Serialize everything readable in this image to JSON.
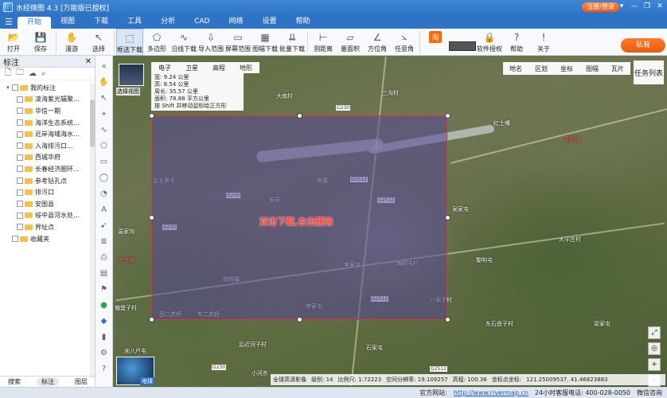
{
  "app": {
    "title": "水经微图 4.3 [万能版已授权]",
    "login_label": "注册/登录",
    "window_controls": [
      "▾",
      "—",
      "❐",
      "✕"
    ]
  },
  "menu": {
    "items": [
      "开始",
      "视图",
      "下载",
      "工具",
      "分析",
      "CAD",
      "网络",
      "设置",
      "帮助"
    ],
    "active_index": 0
  },
  "toolbar": {
    "buttons": [
      {
        "label": "打开",
        "icon": "folder-open-icon"
      },
      {
        "label": "保存",
        "icon": "save-icon"
      },
      {
        "label": "漫游",
        "icon": "hand-icon"
      },
      {
        "label": "选择",
        "icon": "pointer-icon"
      },
      {
        "label": "框选下载",
        "icon": "box-select-icon",
        "selected": true
      },
      {
        "label": "多边形",
        "icon": "polygon-icon"
      },
      {
        "label": "沿线下载",
        "icon": "line-download-icon"
      },
      {
        "label": "导入范围",
        "icon": "import-icon"
      },
      {
        "label": "屏幕范围",
        "icon": "screen-icon"
      },
      {
        "label": "图幅下载",
        "icon": "sheet-icon"
      },
      {
        "label": "批量下载",
        "icon": "batch-icon"
      },
      {
        "label": "测距离",
        "icon": "ruler-icon"
      },
      {
        "label": "量面积",
        "icon": "area-icon"
      },
      {
        "label": "方位角",
        "icon": "azimuth-icon"
      },
      {
        "label": "任意角",
        "icon": "angle-icon"
      },
      {
        "label": "软件授权",
        "icon": "lock-icon"
      },
      {
        "label": "帮助",
        "icon": "help-icon"
      },
      {
        "label": "关于",
        "icon": "info-icon"
      }
    ],
    "tao_label": "淘",
    "promo_label": "私有"
  },
  "left_panel": {
    "title": "标注",
    "root": "我的标注",
    "items": [
      "凌海紫光辐聚…",
      "华信一期",
      "海洋生态系统…",
      "近岸海域海水…",
      "入海排污口…",
      "西城华府",
      "长春经济圈环…",
      "参考钻孔点",
      "排污口",
      "安图县",
      "绥中县河水处…",
      "界址点"
    ],
    "favorites": "收藏夹",
    "tabs": [
      "搜索",
      "标注",
      "图层"
    ],
    "active_tab": 1
  },
  "map": {
    "thumbnail_label": "选择视图",
    "type_tabs": [
      "电子",
      "卫星",
      "高程",
      "地形"
    ],
    "info": {
      "line1": "宽: 9.24 公里",
      "line2": "高: 8.54 公里",
      "perimeter": "周长: 35.57 公里",
      "area": "面积: 78.88 平方公里",
      "shift_hint": "按 Shift 并移动鼠标绘正方形"
    },
    "right_tools": [
      "地名",
      "区划",
      "坐标",
      "图幅",
      "瓦片"
    ],
    "task_list": "任务列表",
    "selection_hint": "双击下载,右击删除",
    "places": [
      {
        "name": "大南村"
      },
      {
        "name": "三沟村"
      },
      {
        "name": "红土嘴"
      },
      {
        "name": "后五里屯"
      },
      {
        "name": "景春"
      },
      {
        "name": "安县"
      },
      {
        "name": "吴家屯"
      },
      {
        "name": "温家沟"
      },
      {
        "name": "大平庄村"
      },
      {
        "name": "黎明屯"
      },
      {
        "name": "李家屯"
      },
      {
        "name": "海顺屯村"
      },
      {
        "name": "前杨镇"
      },
      {
        "name": "八家子村"
      },
      {
        "name": "西二虎桥"
      },
      {
        "name": "东二虎桥"
      },
      {
        "name": "李家屯"
      },
      {
        "name": "东石盘子村"
      },
      {
        "name": "宋八户屯"
      },
      {
        "name": "后近河子村"
      },
      {
        "name": "石家屯"
      },
      {
        "name": "小河东"
      },
      {
        "name": "梁家屯"
      },
      {
        "name": "偏堡子村"
      }
    ],
    "road_labels": [
      "G230",
      "G230",
      "G2512",
      "G230",
      "G2512",
      "G2512",
      "G230",
      "G2512"
    ],
    "line_labels": [
      "庄西线",
      "清武线"
    ],
    "globe_label": "地球",
    "status": {
      "source": "全球高清影像",
      "level": "级别: 14",
      "scale": "比例尺: 1:72223",
      "resolution": "空间分辨率: 19.109257",
      "elevation": "高程: 100.36",
      "coord_label": "坐标点坐标:",
      "coords": "121.25009537, 41.46823883"
    }
  },
  "bottom": {
    "site_label": "官方网站:",
    "site_url": "http://www.rivermap.cn",
    "hotline": "24小时客服电话: 400-028-0050",
    "wechat": "微信咨询"
  }
}
